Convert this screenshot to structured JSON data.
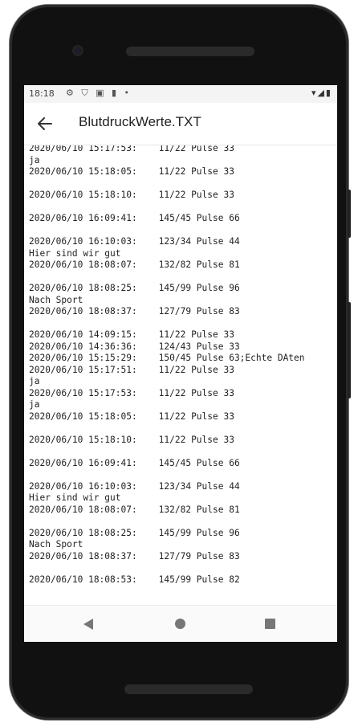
{
  "status_bar": {
    "time": "18:18",
    "left_icons": "⚙ ⛉ ▣ ▮ •",
    "right_icons": "▾◢▮"
  },
  "app_bar": {
    "title": "BlutdruckWerte.TXT"
  },
  "log": {
    "text": "2020/06/10 15:17:53:    11/22 Pulse 33\nja\n2020/06/10 15:18:05:    11/22 Pulse 33\n\n2020/06/10 15:18:10:    11/22 Pulse 33\n\n2020/06/10 16:09:41:    145/45 Pulse 66\n\n2020/06/10 16:10:03:    123/34 Pulse 44\nHier sind wir gut\n2020/06/10 18:08:07:    132/82 Pulse 81\n\n2020/06/10 18:08:25:    145/99 Pulse 96\nNach Sport\n2020/06/10 18:08:37:    127/79 Pulse 83\n\n2020/06/10 14:09:15:    11/22 Pulse 33\n2020/06/10 14:36:36:    124/43 Pulse 33\n2020/06/10 15:15:29:    150/45 Pulse 63;Echte DAten\n2020/06/10 15:17:51:    11/22 Pulse 33\nja\n2020/06/10 15:17:53:    11/22 Pulse 33\nja\n2020/06/10 15:18:05:    11/22 Pulse 33\n\n2020/06/10 15:18:10:    11/22 Pulse 33\n\n2020/06/10 16:09:41:    145/45 Pulse 66\n\n2020/06/10 16:10:03:    123/34 Pulse 44\nHier sind wir gut\n2020/06/10 18:08:07:    132/82 Pulse 81\n\n2020/06/10 18:08:25:    145/99 Pulse 96\nNach Sport\n2020/06/10 18:08:37:    127/79 Pulse 83\n\n2020/06/10 18:08:53:    145/99 Pulse 82"
  },
  "nav_bar": {
    "back_icon": "triangle-back-icon",
    "home_icon": "circle-home-icon",
    "recents_icon": "square-recents-icon"
  },
  "colors": {
    "frame": "#111111",
    "text": "#222222",
    "nav_icons": "#777777"
  }
}
